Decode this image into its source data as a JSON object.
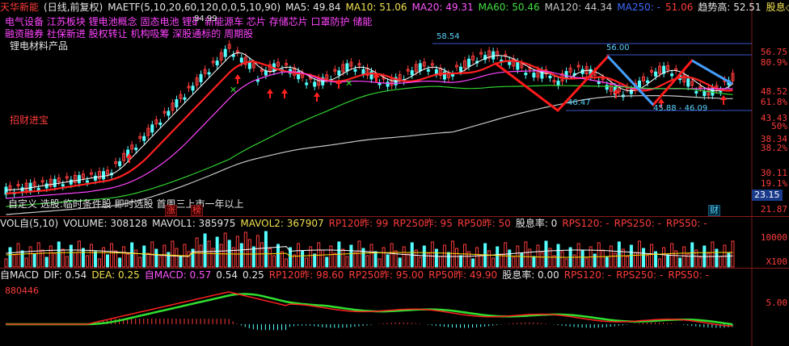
{
  "main_header": {
    "stock_name": "天华新能",
    "mode": "(日线,前复权)",
    "ma_formula": "MAETF(5,10,20,60,120,0,0,5,10,90)",
    "ma5": "MA5: 49.84",
    "ma10": "MA10: 51.06",
    "ma20": "MA20: 49.31",
    "ma60": "MA60: 50.46",
    "ma120": "MA120: 44.34",
    "ma250": "MA250: -",
    "ma250_val": "51.06",
    "trend": "趋势高: 52.51",
    "more": "股息◇"
  },
  "sectors": {
    "line1": "电气设备 江苏板块 锂电池概念 固态电池 锂矿 新能源车 芯片 存储芯片 口罩防护 储能",
    "line2": "融资融券 社保新进 股权转让 机构吸筹 深股通标的 周期股"
  },
  "annotations": {
    "concept": "锂电材料产品",
    "zhaocai": "招财进宝",
    "custom": "自定义  选股:临时条件股 即时选股 首周三上市一年以上",
    "price_label_1": "58.54",
    "price_label_2": "56.00",
    "price_label_3": "45.88 - 46.09",
    "price_label_4": "46.47",
    "price_label_5": "84.99",
    "badge_zhang": "涨",
    "badge_bang": "榜",
    "badge_cai": "财",
    "current_price": "23.15"
  },
  "y_axis_main": [
    "56.75",
    "80.9%",
    "48.52",
    "61.8%",
    "43.43",
    "50%",
    "38.34",
    "38.2%",
    "30.11",
    "19.1%",
    "21.87"
  ],
  "vol_header": {
    "vol": "VOL自(5,10)",
    "volume": "VOLUME: 308128",
    "mavol1": "MAVOL1: 385975",
    "mavol2": "MAVOL2: 367907",
    "rp120": "RP120昨: 99",
    "rp250": "RP250昨: 95",
    "rp50": "RP50昨: 50",
    "div": "股息率: 0",
    "rps120": "RPS120: -",
    "rps250": "RPS250: -",
    "rps50": "RPS50: -"
  },
  "y_axis_vol": [
    "10000",
    "X100"
  ],
  "macd_header": {
    "name": "自MACD",
    "dif": "DIF: 0.54",
    "dea": "DEA: 0.25",
    "macd": "自MACD: 0.57",
    "v1": "0.54",
    "v2": "0.25",
    "rp120": "RP120昨: 98.60",
    "rp250": "RP250昨: 95.00",
    "rp50": "RP50昨: 49.90",
    "div": "股息率: 0.00",
    "rps120": "RPS120: -",
    "rps250": "RPS250: -",
    "rps50": "RPS50: -"
  },
  "macd_code": "880446",
  "y_axis_macd": [
    "5.00"
  ],
  "colors": {
    "up": "#ff3c3c",
    "down": "#54ffff",
    "ma5": "#ffffff",
    "ma10": "#ffdd00",
    "ma20": "#ff44ff",
    "ma60": "#30d030",
    "ma120": "#c8c8c8",
    "bg": "#000000"
  }
}
